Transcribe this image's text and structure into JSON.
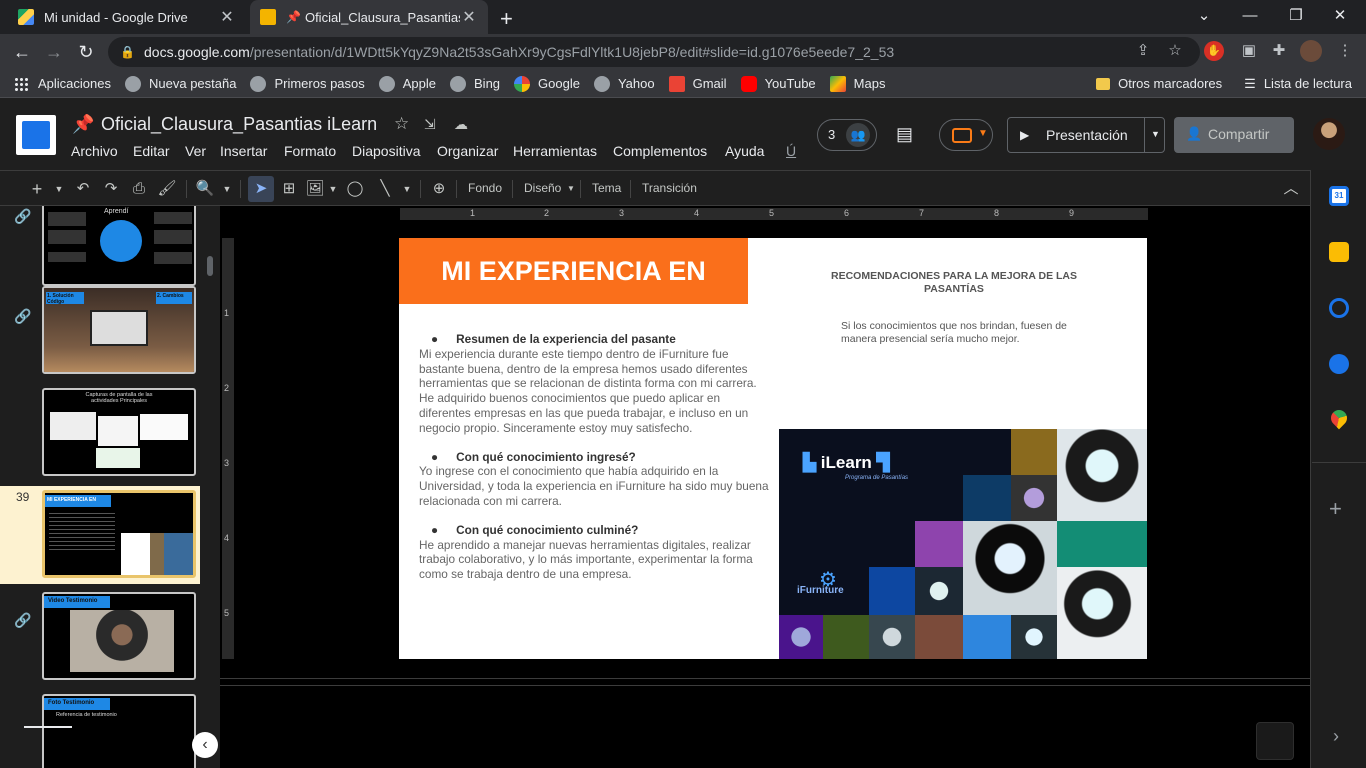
{
  "browser": {
    "tabs": [
      {
        "title": "Mi unidad - Google Drive",
        "active": false
      },
      {
        "title": "Oficial_Clausura_Pasantias iLe",
        "active": true
      }
    ],
    "new_tab": "+",
    "url_host": "docs.google.com",
    "url_path": "/presentation/d/1WDtt5kYqyZ9Na2t53sGahXr9yCgsFdlYltk1U8jebP8/edit#slide=id.g1076e5eede7_2_53",
    "bookmarks": [
      "Aplicaciones",
      "Nueva pestaña",
      "Primeros pasos",
      "Apple",
      "Bing",
      "Google",
      "Yahoo",
      "Gmail",
      "YouTube",
      "Maps"
    ],
    "bookmarks_right": [
      "Otros marcadores",
      "Lista de lectura"
    ]
  },
  "slides": {
    "doc_title": "Oficial_Clausura_Pasantias iLearn",
    "menus": [
      "Archivo",
      "Editar",
      "Ver",
      "Insertar",
      "Formato",
      "Diapositiva",
      "Organizar",
      "Herramientas",
      "Complementos",
      "Ayuda",
      "Ú"
    ],
    "collab_count": "3",
    "present_label": "Presentación",
    "share_label": "Compartir",
    "toolbar_text": [
      "Fondo",
      "Diseño",
      "Tema",
      "Transición"
    ],
    "ruler_labels": [
      "1",
      "2",
      "3",
      "4",
      "5",
      "6",
      "7",
      "8",
      "9"
    ],
    "vruler_labels": [
      "1",
      "2",
      "3",
      "4",
      "5"
    ]
  },
  "filmstrip": {
    "slide_number": "39",
    "thumbs": {
      "t1_title": "Aprendí",
      "t2_tag1": "1. Solución Código",
      "t2_tag2": "2. Cambios",
      "t3_title": "Capturas de pantalla de las actividades Principales",
      "t4_title": "MI EXPERIENCIA EN",
      "t5_title": "Video Testimonio",
      "t6_title": "Foto Testimonio",
      "t6_sub": "Referencia de testimonio"
    }
  },
  "slide": {
    "banner": "MI EXPERIENCIA EN",
    "right_heading": "RECOMENDACIONES PARA LA MEJORA DE LAS PASANTÍAS",
    "right_text": "Si los conocimientos que nos brindan, fuesen de manera presencial sería mucho mejor.",
    "section1_title": "Resumen de la experiencia del pasante",
    "section1_body": "Mi experiencia durante este tiempo dentro de iFurniture fue bastante buena, dentro de  la empresa hemos usado diferentes herramientas que se relacionan de distinta forma con mi carrera. He adquirido buenos conocimientos que puedo aplicar en diferentes  empresas en las que pueda trabajar, e incluso en un negocio propio. Sinceramente estoy muy satisfecho.",
    "section2_title": "Con qué conocimiento ingresé?",
    "section2_body": "Yo ingrese con el conocimiento que había adquirido  en la Universidad, y  toda la experiencia en iFurniture ha sido muy buena relacionada con mi carrera.",
    "section3_title": "Con qué conocimiento culminé?",
    "section3_body": "He aprendido a manejar nuevas  herramientas digitales, realizar  trabajo colaborativo, y lo más importante, experimentar la forma como se trabaja dentro de una empresa.",
    "image_logo": "iLearn",
    "image_sub": "Programa de Pasantías",
    "image_brand": "iFurniture"
  },
  "colors": {
    "accent_orange": "#fa6f1b",
    "share_bg": "#5f6368",
    "selected_border": "#e9c46a"
  }
}
